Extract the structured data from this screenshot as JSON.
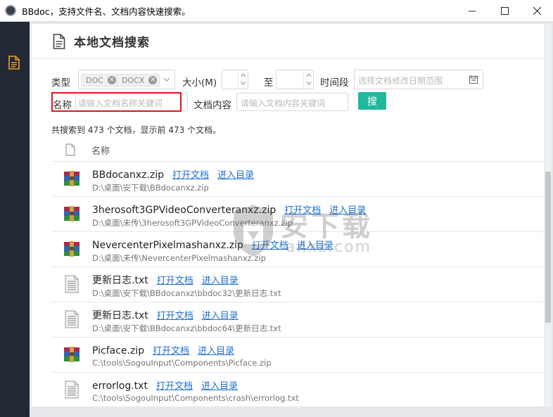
{
  "window": {
    "title": "BBdoc，支持文件名、文档内容快速搜索。",
    "controls": [
      "minimize-icon",
      "maximize-icon",
      "close-icon"
    ]
  },
  "sidebar": {
    "items": [
      {
        "icon": "document-icon",
        "active": true
      }
    ]
  },
  "header": {
    "title": "本地文档搜索"
  },
  "filters": {
    "type_label": "类型",
    "type_tags": [
      "DOC",
      "DOCX"
    ],
    "size_label": "大小(M)",
    "size_min": "",
    "size_to": "至",
    "size_max": "",
    "period_label": "时间段",
    "period_placeholder": "选择文档修改日期范围",
    "name_label": "名称",
    "name_placeholder": "请输入文档名称关键词",
    "content_label": "文档内容",
    "content_placeholder": "请输入文档内容关键词",
    "search_button": "搜"
  },
  "summary": "共搜索到 473 个文档，显示前 473 个文档。",
  "list": {
    "header_name": "名称",
    "open_label": "打开文档",
    "dir_label": "进入目录",
    "rows": [
      {
        "name": "BBdocanxz.zip",
        "path": "D:\\桌面\\安下载\\BBdocanxz.zip",
        "icon": "zip-archive-icon"
      },
      {
        "name": "3herosoft3GPVideoConverteranxz.zip",
        "path": "D:\\桌面\\未传\\3herosoft3GPVideoConverteranxz.zip",
        "icon": "zip-archive-icon"
      },
      {
        "name": "NevercenterPixelmashanxz.zip",
        "path": "D:\\桌面\\未传\\NevercenterPixelmashanxz.zip",
        "icon": "zip-archive-icon"
      },
      {
        "name": "更新日志.txt",
        "path": "D:\\桌面\\安下载\\BBdocanxz\\bbdoc32\\更新日志.txt",
        "icon": "text-file-icon"
      },
      {
        "name": "更新日志.txt",
        "path": "D:\\桌面\\安下载\\BBdocanxz\\bbdoc64\\更新日志.txt",
        "icon": "text-file-icon"
      },
      {
        "name": "Picface.zip",
        "path": "C:\\tools\\SogouInput\\Components\\Picface.zip",
        "icon": "zip-archive-icon"
      },
      {
        "name": "errorlog.txt",
        "path": "C:\\tools\\SogouInput\\Components\\crash\\errorlog.txt",
        "icon": "text-file-icon"
      }
    ]
  },
  "watermark": {
    "text": "安下载",
    "sub": "anxz.com"
  },
  "colors": {
    "accent": "#1fb89c",
    "sidebar": "#222834",
    "link": "#1f6fd1",
    "highlight": "#e0141e"
  }
}
